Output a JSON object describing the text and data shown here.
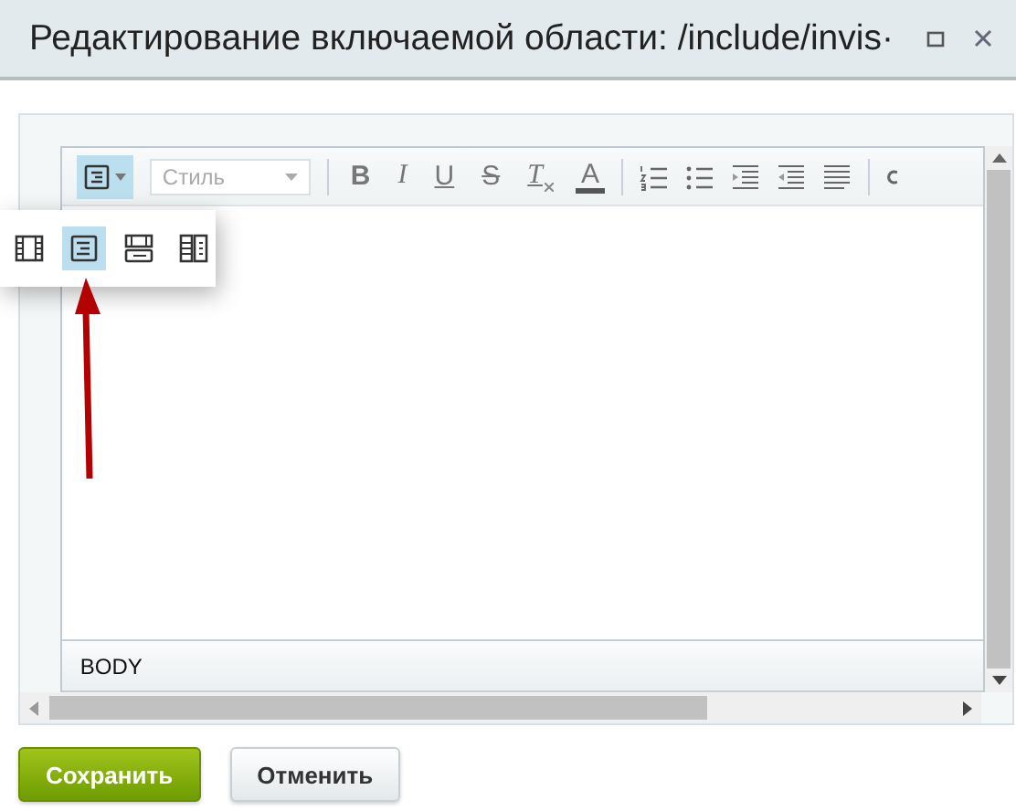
{
  "window": {
    "title": "Редактирование включаемой области: /include/invis·"
  },
  "toolbar": {
    "mode_button": {
      "selected": true
    },
    "style_select": {
      "placeholder": "Стиль"
    },
    "groups": [
      [
        {
          "kind": "bold",
          "label": "B"
        },
        {
          "kind": "italic",
          "label": "I"
        },
        {
          "kind": "underline",
          "label": "U"
        },
        {
          "kind": "strike",
          "label": "S"
        },
        {
          "kind": "clear",
          "label": "T"
        },
        {
          "kind": "color",
          "label": "A"
        }
      ],
      [
        {
          "kind": "ordered-list"
        },
        {
          "kind": "bullet-list"
        },
        {
          "kind": "indent"
        },
        {
          "kind": "outdent"
        },
        {
          "kind": "justify"
        }
      ],
      [
        {
          "kind": "cut"
        }
      ]
    ]
  },
  "mode_popup": {
    "items": [
      {
        "kind": "code",
        "selected": false
      },
      {
        "kind": "visual",
        "selected": true
      },
      {
        "kind": "split-horizontal",
        "selected": false
      },
      {
        "kind": "split-vertical",
        "selected": false
      }
    ]
  },
  "status_bar": {
    "path": "BODY"
  },
  "buttons": [
    {
      "kind": "primary",
      "label": "Сохранить"
    },
    {
      "kind": "secondary",
      "label": "Отменить"
    }
  ]
}
